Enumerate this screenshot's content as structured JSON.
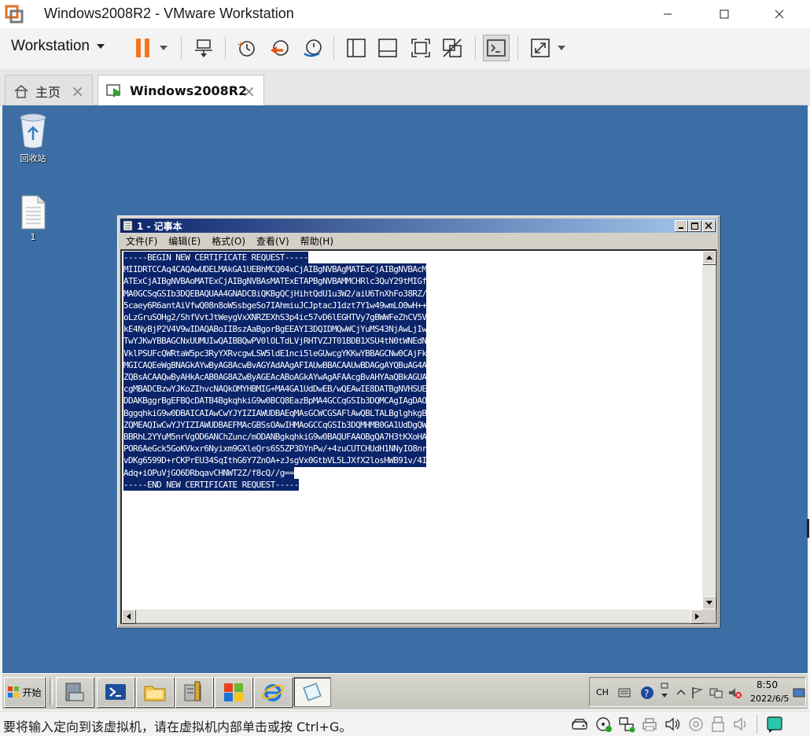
{
  "window": {
    "title": "Windows2008R2 - VMware Workstation"
  },
  "toolbar": {
    "workstation_menu": "Workstation"
  },
  "tabs": [
    {
      "label": "主页",
      "active": false
    },
    {
      "label": "Windows2008R2",
      "active": true
    }
  ],
  "desktop": {
    "icons": [
      {
        "label": "回收站",
        "icon": "recycle-bin-icon"
      },
      {
        "label": "1",
        "icon": "text-file-icon"
      }
    ]
  },
  "notepad": {
    "title": "1 - 记事本",
    "menu": [
      "文件(F)",
      "编辑(E)",
      "格式(O)",
      "查看(V)",
      "帮助(H)"
    ],
    "lines": [
      "-----BEGIN NEW CERTIFICATE REQUEST-----",
      "MIIDRTCCAq4CAQAwUDELMAkGA1UEBhMCQ04xCjAIBgNVBAgMATExCjAIBgNVBAcM",
      "ATExCjAIBgNVBAoMATExCjAIBgNVBAsMATExETAPBgNVBAMMCHRlc3QuY29tMIGf",
      "MA0GCSqGSIb3DQEBAQUAA4GNADCBiQKBgQCjHihtQdU1u3W2/aiU6TnXhFo38RZ/",
      "5caey6R6antAiVfwQ08n8oWSsbgeSo7IAhmiuJCJptacJ1dzt7Y1w49wmLO0wH++",
      "oLzGruSOHg2/ShfVvtJtWeygVxXNRZEXhS3p4ic57vD6lEGHTVy7gBWWFeZhCV5V",
      "kE4NyBjP2V4V9wIDAQABoIIBszAaBgorBgEEAYI3DQIDMQwWCjYuMS43NjAwLjIw",
      "TwYJKwYBBAGCNxUUMUIwQAIBBQwPV0lOLTdLVjRHTVZJT01BDB1XSU4tN0tWNEdN",
      "VklPSUFcQWRtaW5pc3RyYXRvcgwLSW5ldE1nci5leGUwcgYKKwYBBAGCNw0CAjFk",
      "MGICAQEeWgBNAGkAYwByAG8AcwBvAGYAdAAgAFIAUwBBACAAUwBDAGgAYQBuAG4A",
      "ZQBsACAAQwByAHkAcAB0AG8AZwByAGEAcABoAGkAYwAgAFAAcgBvAHYAaQBkAGUA",
      "cgMBADCBzwYJKoZIhvcNAQkOMYHBMIG+MA4GA1UdDwEB/wQEAwIE8DATBgNVHSUE",
      "DDAKBggrBgEFBQcDATB4BgkqhkiG9w0BCQ8EazBpMA4GCCqGSIb3DQMCAgIAgDAO",
      "BggqhkiG9w0DBAICAIAwCwYJYIZIAWUDBAEqMAsGCWCGSAFlAwQBLTALBglghkgB",
      "ZQMEAQIwCwYJYIZIAWUDBAEFMAcGBSsOAwIHMAoGCCqGSIb3DQMHMB0GA1UdDgQW",
      "BBRhL2YYuM5nrVgOD6ANChZunc/mODANBgkqhkiG9w0BAQUFAAOBgQA7H3tKXoHA",
      "POR6AeGck5GoKVkxr6Nyixm9GXleQrs6S5ZP3DYnPw/+4zuCUTCHUdH1NNyIO8nr",
      "vDKg6599D+rCKPrEU34SqIthG6Y7ZnOA+zJsgVx0GtbVL5LJXfX2losHWB91v/4I",
      "Adq+iOPuVjGO6DRbqavCHNWT2Z/f8cQ//g==",
      "-----END NEW CERTIFICATE REQUEST-----"
    ]
  },
  "taskbar": {
    "start_label": "开始",
    "lang": "CH",
    "time": "8:50",
    "date": "2022/6/5"
  },
  "statusbar": {
    "message": "要将输入定向到该虚拟机，请在虚拟机内部单击或按 Ctrl+G。"
  },
  "colors": {
    "desktop": "#3c6ea5",
    "selection": "#0a246a",
    "pause_orange": "#f07820"
  }
}
